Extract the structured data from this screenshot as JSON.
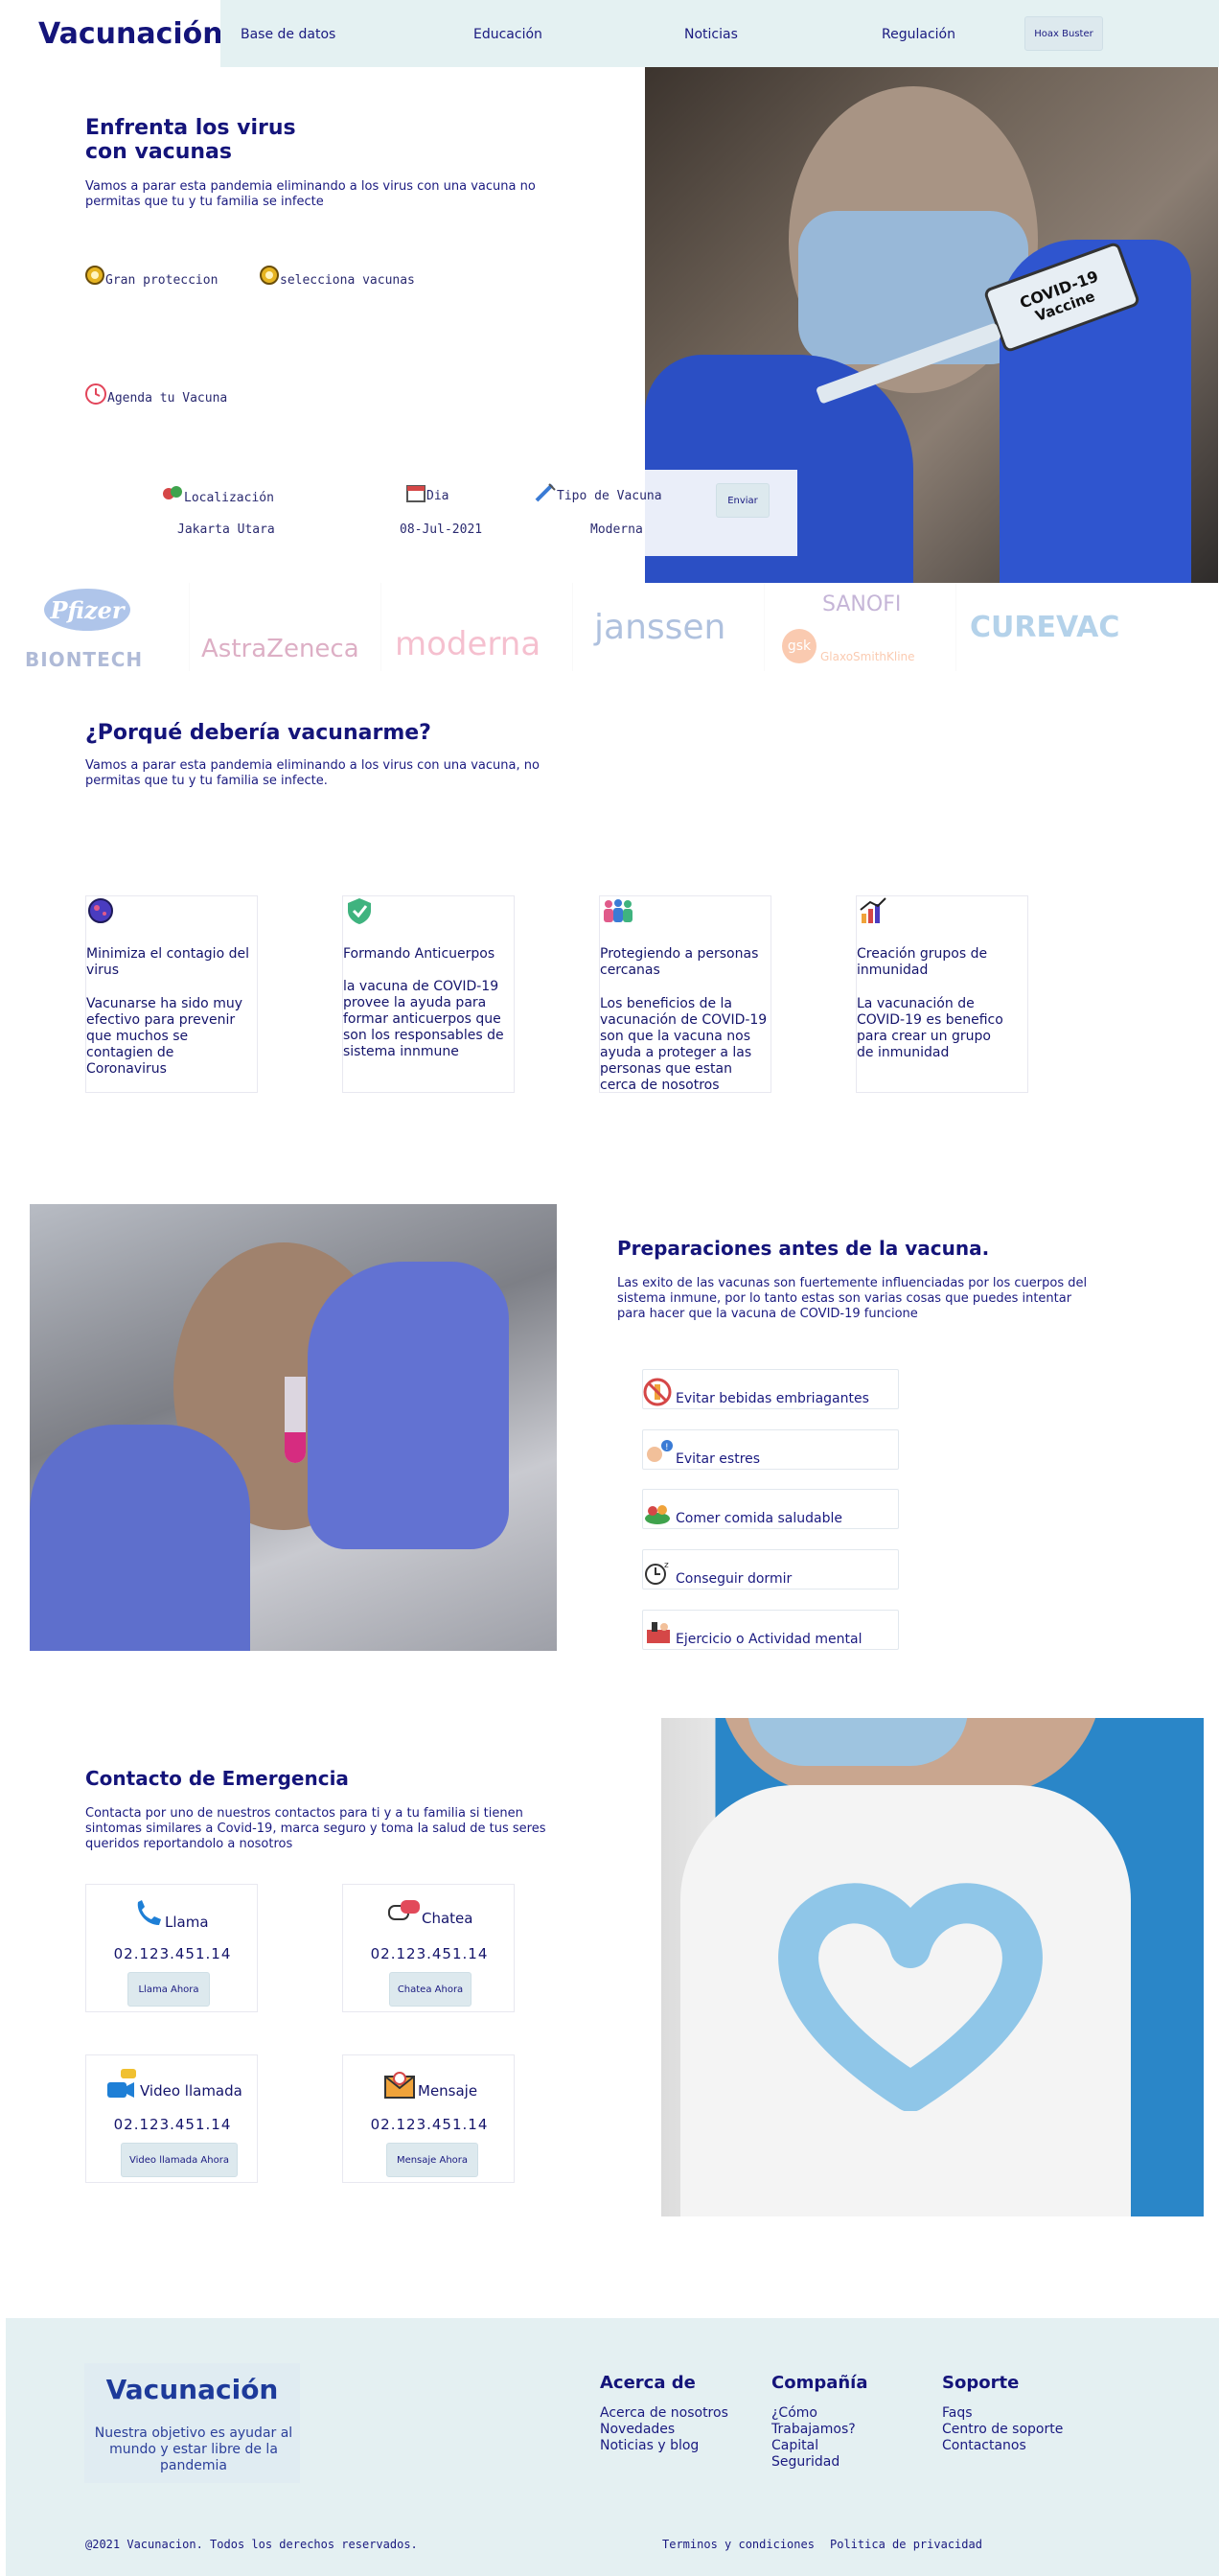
{
  "brand": "Vacunación",
  "nav": {
    "items": [
      "Base de datos",
      "Educación",
      "Noticias",
      "Regulación"
    ],
    "cta": "Hoax Buster"
  },
  "hero": {
    "title_line1": "Enfrenta los virus",
    "title_line2": "con vacunas",
    "desc": "Vamos a parar esta pandemia eliminando a los virus con una vacuna no permitas que tu y tu familia se infecte",
    "badges": [
      "Gran proteccion",
      "selecciona vacunas"
    ],
    "schedule": "Agenda tu Vacuna",
    "form": {
      "location_label": "Localización",
      "location_value": "Jakarta Utara",
      "day_label": "Dia",
      "day_value": "08-Jul-2021",
      "type_label": "Tipo de Vacuna",
      "type_value": "Moderna",
      "submit": "Enviar"
    },
    "image_text": [
      "COVID-19",
      "Vaccine"
    ]
  },
  "brands": [
    "Pfizer",
    "BIONTECH",
    "AstraZeneca",
    "moderna",
    "janssen",
    "SANOFI",
    "gsk",
    "GlaxoSmithKline",
    "CUREVAC"
  ],
  "why": {
    "title": "¿Porqué debería vacunarme?",
    "desc": "Vamos a parar esta pandemia eliminando a los virus con una vacuna, no permitas que tu y tu familia se infecte.",
    "cards": [
      {
        "title": "Minimiza el contagio del virus",
        "body": "Vacunarse ha sido muy efectivo para prevenir que muchos se contagien de Coronavirus",
        "icon": "virus-icon"
      },
      {
        "title": "Formando Anticuerpos",
        "body": "la vacuna de COVID-19 provee la ayuda para formar anticuerpos que son los responsables de sistema innmune",
        "icon": "shield-check-icon"
      },
      {
        "title": "Protegiendo a personas cercanas",
        "body": "Los beneficios de la vacunación de COVID-19 son que la vacuna nos ayuda a proteger a las personas que estan cerca de nosotros",
        "icon": "family-icon"
      },
      {
        "title": "Creación grupos de inmunidad",
        "body": "La vacunación de COVID-19 es benefico para crear un grupo de inmunidad",
        "icon": "growth-chart-icon"
      }
    ]
  },
  "prep": {
    "title": "Preparaciones antes de la vacuna.",
    "desc": "Las exito de las vacunas son fuertemente influenciadas por los cuerpos del sistema inmune, por lo tanto estas son varias cosas que puedes intentar para hacer que la vacuna de COVID-19 funcione",
    "items": [
      "Evitar bebidas embriagantes",
      "Evitar estres",
      "Comer comida saludable",
      "Conseguir dormir",
      "Ejercicio o Actividad mental"
    ]
  },
  "contact": {
    "title": "Contacto de Emergencia",
    "desc": "Contacta por uno de nuestros contactos para ti y a tu familia si tienen sintomas similares a Covid-19, marca seguro y toma la salud de tus seres queridos reportandolo a nosotros",
    "cards": [
      {
        "title": "Llama",
        "number": "02.123.451.14",
        "button": "Llama Ahora"
      },
      {
        "title": "Chatea",
        "number": "02.123.451.14",
        "button": "Chatea Ahora"
      },
      {
        "title": "Video llamada",
        "number": "02.123.451.14",
        "button": "Video llamada Ahora"
      },
      {
        "title": "Mensaje",
        "number": "02.123.451.14",
        "button": "Mensaje Ahora"
      }
    ]
  },
  "footer": {
    "brand": "Vacunación",
    "tagline": "Nuestra objetivo es ayudar al mundo y estar libre de la pandemia",
    "cols": [
      {
        "title": "Acerca de",
        "links": [
          "Acerca de nosotros",
          "Novedades",
          "Noticias y blog"
        ]
      },
      {
        "title": "Compañía",
        "links": [
          "¿Cómo",
          "Trabajamos?",
          "Capital",
          "Seguridad"
        ]
      },
      {
        "title": "Soporte",
        "links": [
          "Faqs",
          "Centro de soporte",
          "Contactanos"
        ]
      }
    ],
    "copyright": "@2021 Vacunacion. Todos los derechos reservados.",
    "legal": [
      "Terminos y condiciones",
      "Politica de privacidad"
    ]
  }
}
